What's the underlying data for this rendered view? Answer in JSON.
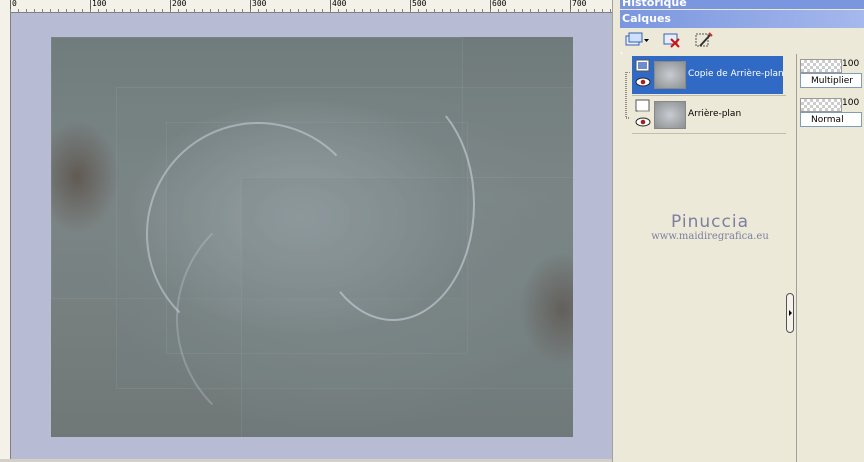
{
  "palettes": {
    "history_title": "Historique",
    "layers_title": "Calques"
  },
  "ruler": {
    "labels": [
      "0",
      "100",
      "200",
      "300",
      "400",
      "500",
      "600",
      "700"
    ]
  },
  "toolbar": {
    "buttons": [
      {
        "icon": "new-layer-icon",
        "has_dropdown": true
      },
      {
        "icon": "delete-layer-icon"
      },
      {
        "icon": "layer-properties-icon"
      }
    ]
  },
  "layers": [
    {
      "name": "Copie de Arrière-plan",
      "opacity": "100",
      "blend_mode": "Multiplier",
      "selected": true,
      "visible": true
    },
    {
      "name": "Arrière-plan",
      "opacity": "100",
      "blend_mode": "Normal",
      "selected": false,
      "visible": true
    }
  ],
  "watermark": {
    "name": "Pinuccia",
    "url": "www.maidiregrafica.eu"
  },
  "colors": {
    "title_bar": "#7a96df",
    "selection": "#316ac5",
    "panel": "#ece9d8"
  }
}
